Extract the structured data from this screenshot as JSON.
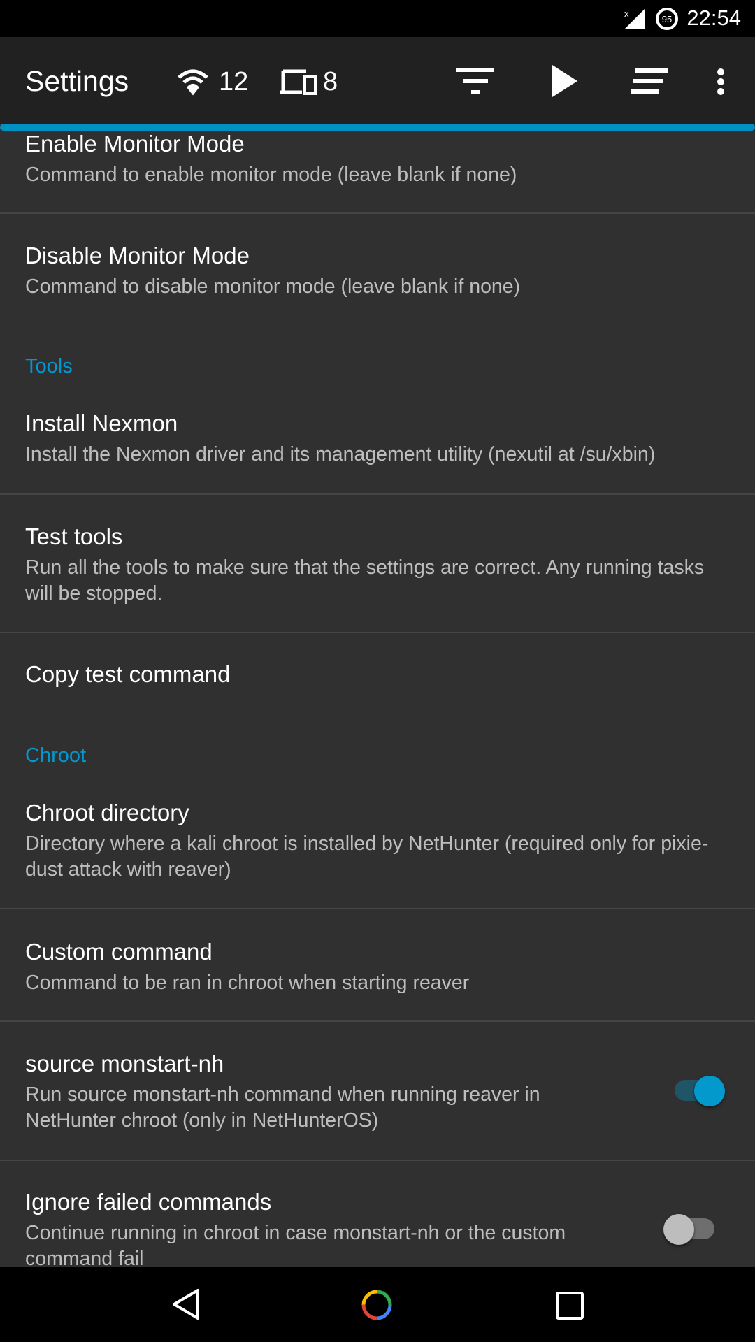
{
  "status_bar": {
    "time": "22:54",
    "battery": "95"
  },
  "toolbar": {
    "title": "Settings",
    "networks_count": "12",
    "devices_count": "8"
  },
  "progress": {
    "percent": 100
  },
  "items": [
    {
      "title": "Enable Monitor Mode",
      "subtitle": "Command to enable monitor mode (leave blank if none)"
    },
    {
      "title": "Disable Monitor Mode",
      "subtitle": "Command to disable monitor mode (leave blank if none)"
    },
    {
      "title": "Install Nexmon",
      "subtitle": "Install the Nexmon driver and its management utility (nexutil at /su/xbin)"
    },
    {
      "title": "Test tools",
      "subtitle": "Run all the tools to make sure that the settings are correct. Any running tasks will be stopped."
    },
    {
      "title": "Copy test command"
    },
    {
      "title": "Chroot directory",
      "subtitle": "Directory where a kali chroot is installed by NetHunter (required only for pixie-dust attack with reaver)"
    },
    {
      "title": "Custom command",
      "subtitle": "Command to be ran in chroot when starting reaver"
    },
    {
      "title": "source monstart-nh",
      "subtitle": "Run source monstart-nh command when running reaver in NetHunter chroot (only in NetHunterOS)",
      "checked": true
    },
    {
      "title": "Ignore failed commands",
      "subtitle": "Continue running in chroot in case monstart-nh or the custom command fail",
      "checked": false
    }
  ],
  "categories": {
    "tools": "Tools",
    "chroot": "Chroot"
  },
  "colors": {
    "accent": "#0397cf",
    "toolbar": "#212121",
    "background": "#303030"
  }
}
